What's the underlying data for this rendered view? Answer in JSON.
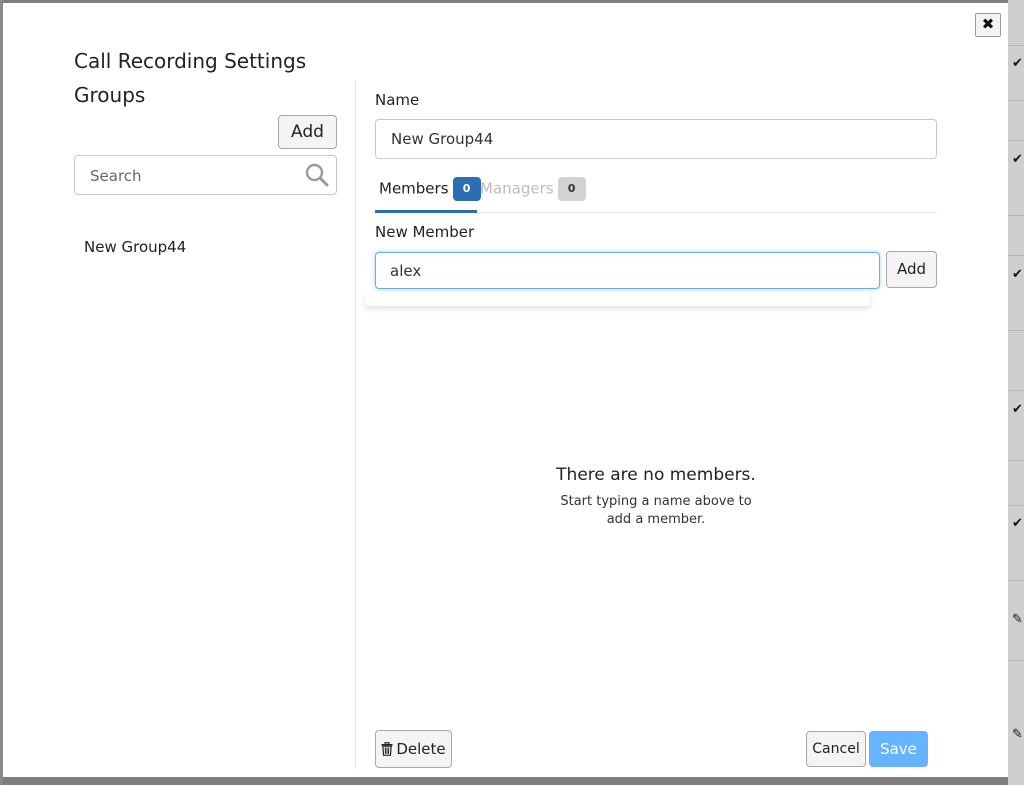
{
  "dialog": {
    "title": "Call Recording Settings",
    "close_icon": "close-icon"
  },
  "groups": {
    "title": "Groups",
    "add_label": "Add",
    "search_placeholder": "Search",
    "items": [
      "New Group44"
    ]
  },
  "editor": {
    "name_label": "Name",
    "name_value": "New Group44",
    "tabs": [
      {
        "label": "Members",
        "count": "0",
        "active": true
      },
      {
        "label": "Managers",
        "count": "0",
        "active": false
      }
    ],
    "new_member_label": "New Member",
    "new_member_value": "alex",
    "add_member_label": "Add",
    "empty_title": "There are no members.",
    "empty_subtitle": "Start typing a name above to add a member.",
    "delete_label": "Delete",
    "cancel_label": "Cancel",
    "save_label": "Save"
  },
  "colors": {
    "accent": "#2d6db3",
    "save_button": "#66b3ff",
    "focus_border": "#66afe9"
  }
}
